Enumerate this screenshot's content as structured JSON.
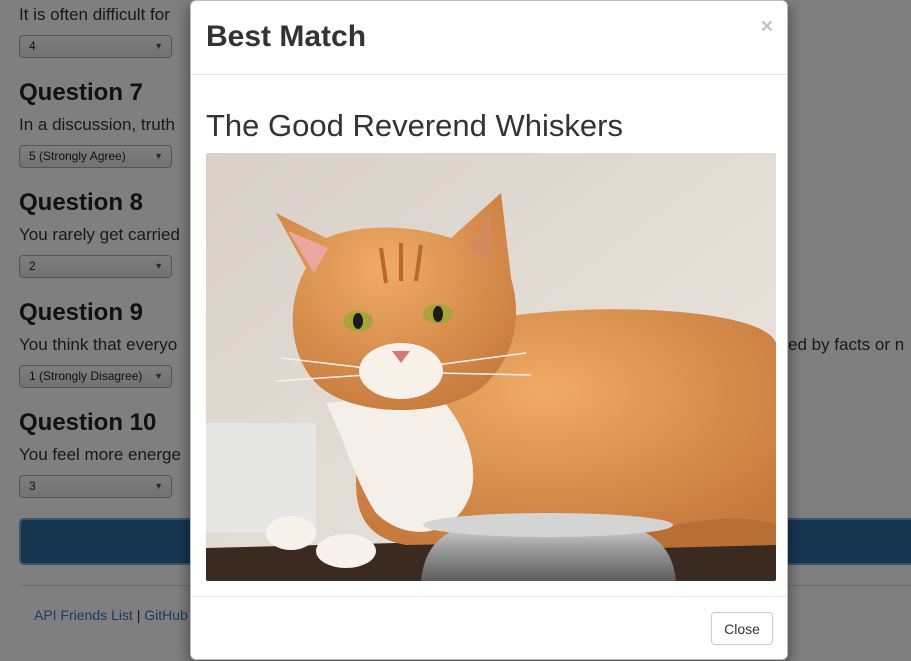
{
  "survey": {
    "q6": {
      "text": "It is often difficult for",
      "answer": "4"
    },
    "q7": {
      "heading": "Question 7",
      "text": "In a discussion, truth",
      "answer": "5 (Strongly Agree)"
    },
    "q8": {
      "heading": "Question 8",
      "text": "You rarely get carried",
      "answer": "2"
    },
    "q9": {
      "heading": "Question 9",
      "text": "You think that everyo",
      "text_right": "ed by facts or n",
      "answer": "1 (Strongly Disagree)"
    },
    "q10": {
      "heading": "Question 10",
      "text": "You feel more energe",
      "answer": "3"
    }
  },
  "footer": {
    "link1": "API Friends List",
    "separator": "|",
    "link2": "GitHub"
  },
  "modal": {
    "title": "Best Match",
    "close_symbol": "×",
    "match_name": "The Good Reverend Whiskers",
    "close_label": "Close"
  },
  "colors": {
    "submit_button": "#2e6da4",
    "link": "#337ab7",
    "overlay": "rgba(0,0,0,0.5)"
  },
  "icons": {
    "dropdown": "caret-down-icon",
    "dismiss": "close-icon"
  }
}
